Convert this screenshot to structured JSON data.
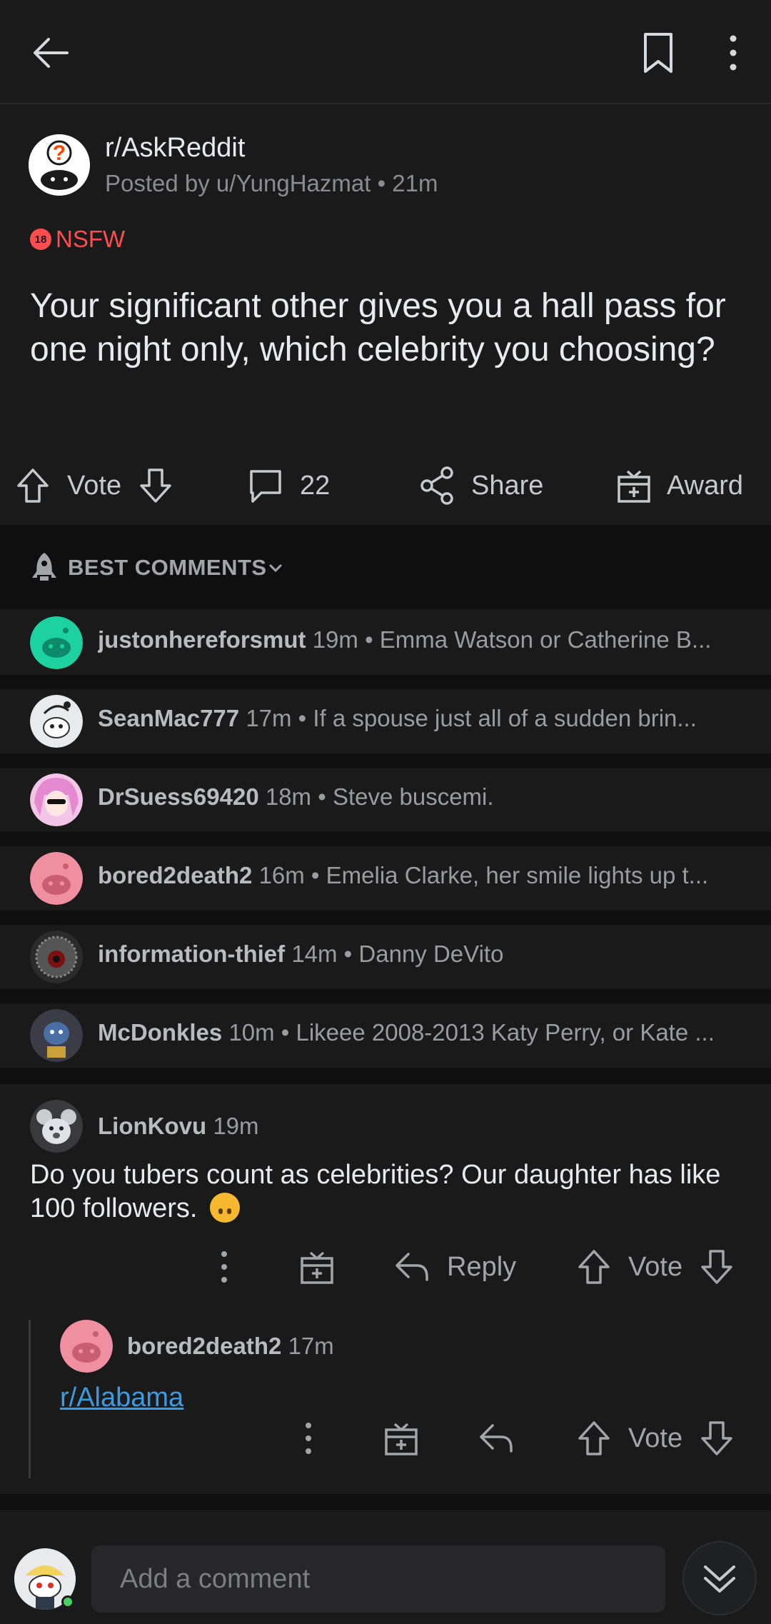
{
  "post": {
    "subreddit": "r/AskReddit",
    "posted_by": "Posted by u/YungHazmat • 21m",
    "nsfw_badge": "18",
    "nsfw_label": "NSFW",
    "title": "Your significant other gives you a hall pass for one night only, which celebrity you choosing?",
    "vote_label": "Vote",
    "comment_count": "22",
    "share_label": "Share",
    "award_label": "Award"
  },
  "sort": {
    "label": "BEST COMMENTS"
  },
  "collapsed_comments": [
    {
      "user": "justonhereforsmut",
      "age": "19m",
      "preview": "Emma Watson or Catherine B..."
    },
    {
      "user": "SeanMac777",
      "age": "17m",
      "preview": "If a spouse just all of a sudden brin..."
    },
    {
      "user": "DrSuess69420",
      "age": "18m",
      "preview": "Steve buscemi."
    },
    {
      "user": "bored2death2",
      "age": "16m",
      "preview": "Emelia Clarke, her smile lights up t..."
    },
    {
      "user": "information-thief",
      "age": "14m",
      "preview": "Danny DeVito"
    },
    {
      "user": "McDonkles",
      "age": "10m",
      "preview": "Likeee 2008-2013 Katy Perry, or Kate ..."
    }
  ],
  "comment": {
    "user": "LionKovu",
    "age": "19m",
    "body": "Do you tubers count as celebrities? Our daughter has like 100 followers.",
    "reply_label": "Reply",
    "vote_label": "Vote"
  },
  "reply": {
    "user": "bored2death2",
    "age": "17m",
    "link": "r/Alabama",
    "vote_label": "Vote"
  },
  "composer": {
    "placeholder": "Add a comment"
  },
  "colors": {
    "background": "#1a1a1b",
    "nsfw": "#ff4d4f",
    "link": "#3b9ae1",
    "online": "#46d160"
  }
}
